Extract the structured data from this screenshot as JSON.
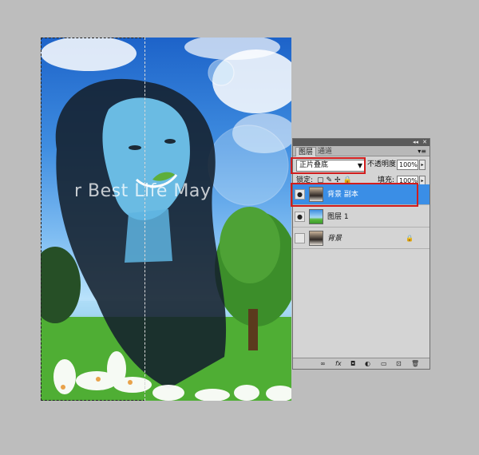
{
  "canvas": {
    "overlay_text": "r Best Life May"
  },
  "panel": {
    "collapse_glyph": "◂◂",
    "close_glyph": "✕",
    "tabs": [
      {
        "label": "图层",
        "active": true
      },
      {
        "label": "通道",
        "active": false
      }
    ],
    "menu_glyph": "▾≡",
    "blend_mode": "正片叠底",
    "dropdown_glyph": "▼",
    "opacity_label": "不透明度:",
    "opacity_value": "100%",
    "lock_label": "锁定:",
    "lock_glyphs": "▢✎✢🔒",
    "fill_label": "填充:",
    "fill_value": "100%",
    "spin_glyph": "▸",
    "layers": [
      {
        "name": "背景 副本",
        "visible": true,
        "selected": true,
        "thumb": "portrait",
        "locked": false
      },
      {
        "name": "图层 1",
        "visible": true,
        "selected": false,
        "thumb": "scene",
        "locked": false
      },
      {
        "name": "背景",
        "visible": false,
        "selected": false,
        "thumb": "portrait",
        "locked": true
      }
    ],
    "eye_glyph": "●",
    "lock_badge_glyph": "🔒",
    "bottom_icons": [
      "∞",
      "fx",
      "◘",
      "◐",
      "▭",
      "⊡",
      "🗑"
    ]
  },
  "colors": {
    "highlight": "#d21d1d",
    "selected_layer": "#3a8ee6"
  }
}
